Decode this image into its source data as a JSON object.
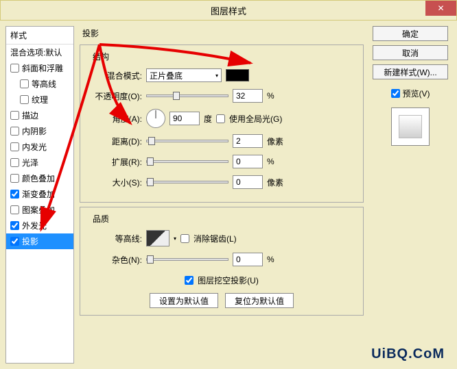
{
  "window": {
    "title": "图层样式",
    "close": "✕"
  },
  "sidebar": {
    "header": "样式",
    "blend": "混合选项:默认",
    "items": [
      {
        "label": "斜面和浮雕",
        "checked": false,
        "indent": 0
      },
      {
        "label": "等高线",
        "checked": false,
        "indent": 1
      },
      {
        "label": "纹理",
        "checked": false,
        "indent": 1
      },
      {
        "label": "描边",
        "checked": false,
        "indent": 0
      },
      {
        "label": "内阴影",
        "checked": false,
        "indent": 0
      },
      {
        "label": "内发光",
        "checked": false,
        "indent": 0
      },
      {
        "label": "光泽",
        "checked": false,
        "indent": 0
      },
      {
        "label": "颜色叠加",
        "checked": false,
        "indent": 0
      },
      {
        "label": "渐变叠加",
        "checked": true,
        "indent": 0
      },
      {
        "label": "图案叠加",
        "checked": false,
        "indent": 0
      },
      {
        "label": "外发光",
        "checked": true,
        "indent": 0
      },
      {
        "label": "投影",
        "checked": true,
        "indent": 0,
        "selected": true
      }
    ]
  },
  "main": {
    "title": "投影",
    "structure": {
      "legend": "结构",
      "blendMode": {
        "label": "混合模式:",
        "value": "正片叠底"
      },
      "opacity": {
        "label": "不透明度(O):",
        "value": "32",
        "unit": "%",
        "thumb": 32
      },
      "angle": {
        "label": "角度(A):",
        "value": "90",
        "unit": "度",
        "globalLight": "使用全局光(G)",
        "globalChecked": false
      },
      "distance": {
        "label": "距离(D):",
        "value": "2",
        "unit": "像素",
        "thumb": 2
      },
      "spread": {
        "label": "扩展(R):",
        "value": "0",
        "unit": "%",
        "thumb": 0
      },
      "size": {
        "label": "大小(S):",
        "value": "0",
        "unit": "像素",
        "thumb": 0
      }
    },
    "quality": {
      "legend": "品质",
      "contour": {
        "label": "等高线:",
        "antialias": "消除锯齿(L)",
        "antialiasChecked": false
      },
      "noise": {
        "label": "杂色(N):",
        "value": "0",
        "unit": "%",
        "thumb": 0
      },
      "knockout": {
        "label": "图层挖空投影(U)",
        "checked": true
      },
      "setDefault": "设置为默认值",
      "resetDefault": "复位为默认值"
    }
  },
  "right": {
    "ok": "确定",
    "cancel": "取消",
    "newStyle": "新建样式(W)...",
    "preview": "预览(V)",
    "previewChecked": true
  },
  "watermark": "UiBQ.CoM"
}
